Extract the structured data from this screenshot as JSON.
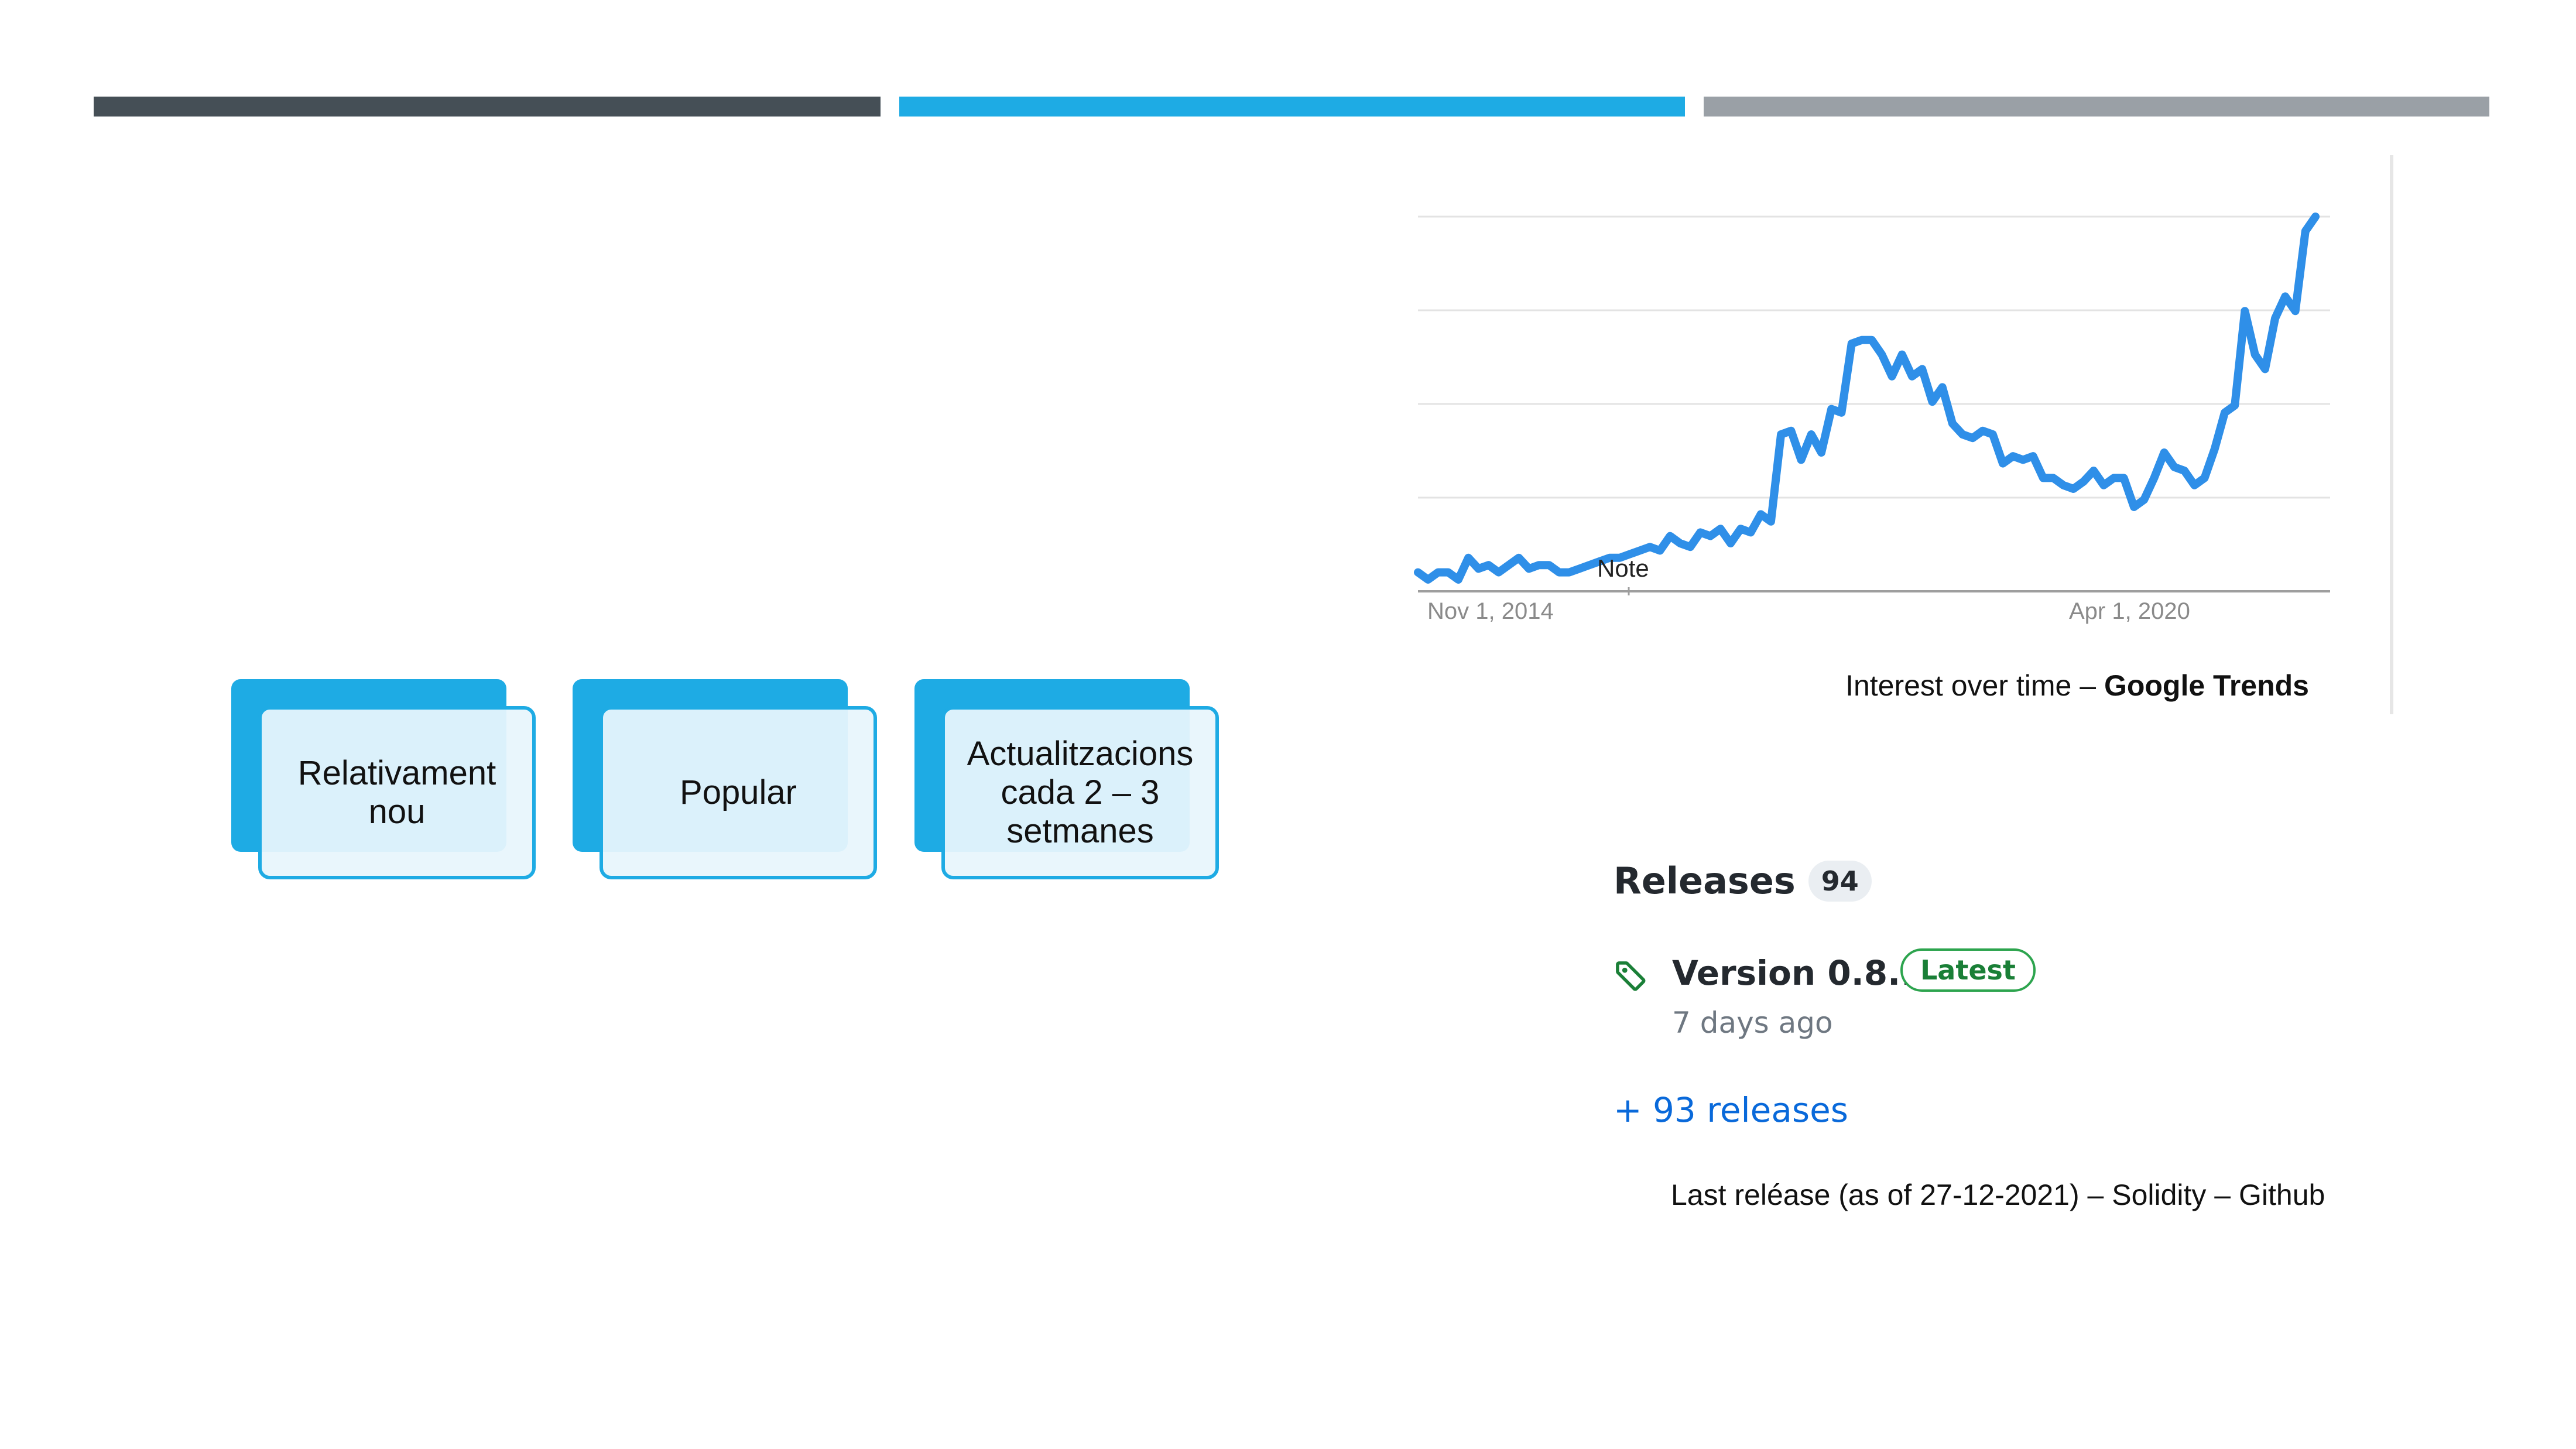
{
  "slide": {
    "accent_colors": [
      "#454f56",
      "#1eabe4",
      "#9aa0a6"
    ]
  },
  "cards": [
    {
      "text": "Relativament\nnou"
    },
    {
      "text": "Popular"
    },
    {
      "text": "Actualitzacions\ncada 2 – 3\nsetmanes"
    }
  ],
  "trend": {
    "note_label": "Note",
    "caption_prefix": "Interest over time – ",
    "caption_source": "Google Trends",
    "line_color": "#2f8fe8"
  },
  "chart_data": {
    "type": "line",
    "x_tick_labels": [
      "Nov 1, 2014",
      "Apr 1, 2020"
    ],
    "annotations": [
      "Note"
    ],
    "ylim": [
      0,
      100
    ],
    "grid": true,
    "values": [
      2,
      0,
      2,
      2,
      0,
      6,
      3,
      4,
      2,
      4,
      6,
      3,
      4,
      4,
      2,
      2,
      3,
      4,
      5,
      6,
      6,
      7,
      8,
      9,
      8,
      12,
      10,
      9,
      13,
      12,
      14,
      10,
      14,
      13,
      18,
      16,
      40,
      41,
      33,
      40,
      35,
      47,
      46,
      65,
      66,
      66,
      62,
      56,
      62,
      56,
      58,
      49,
      53,
      43,
      40,
      39,
      41,
      40,
      32,
      34,
      33,
      34,
      28,
      28,
      26,
      25,
      27,
      30,
      26,
      28,
      28,
      20,
      22,
      28,
      35,
      31,
      30,
      26,
      28,
      36,
      46,
      48,
      74,
      62,
      58,
      72,
      78,
      74,
      96,
      100
    ],
    "series": [
      {
        "values_ref": "values"
      }
    ]
  },
  "releases": {
    "title": "Releases",
    "count": "94",
    "latest_name": "Version 0.8.11",
    "latest_badge": "Latest",
    "latest_date": "7 days ago",
    "more_link": "+ 93 releases",
    "caption": "Last reléase (as of 27-12-2021) – Solidity – Github"
  }
}
